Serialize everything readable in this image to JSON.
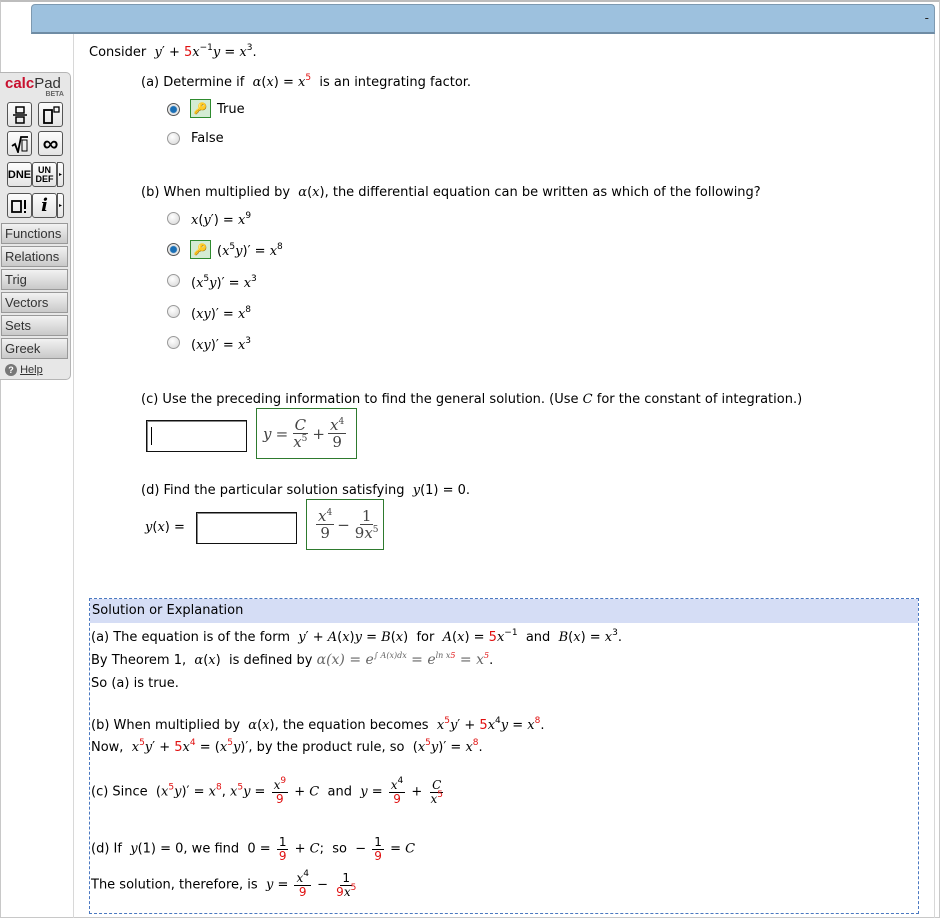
{
  "header": {
    "collapse_label": "-"
  },
  "calcpad": {
    "logo_calc": "calc",
    "logo_pad": "Pad",
    "beta": "BETA",
    "buttons": {
      "fraction": "▭/▭",
      "power": "▯°",
      "sqrt": "√▯",
      "infinity": "∞",
      "dne": "DNE",
      "undef_top": "UN",
      "undef_bottom": "DEF",
      "factorial": "▯!",
      "info": "i",
      "arrow": "▸"
    },
    "menus": [
      "Functions",
      "Relations",
      "Trig",
      "Vectors",
      "Sets",
      "Greek"
    ],
    "help_icon": "?",
    "help_label": "Help"
  },
  "problem": {
    "consider_label": "Consider",
    "part_a": {
      "prompt_pre": "(a) Determine if",
      "prompt_post": "is an integrating factor.",
      "options": [
        {
          "label": "True",
          "selected": true,
          "key_icon": "key-icon"
        },
        {
          "label": "False",
          "selected": false
        }
      ]
    },
    "part_b": {
      "prompt_pre": "(b) When multiplied by",
      "prompt_post": ", the differential equation can be written as which of the following?",
      "options": [
        {
          "label": "x(y') = x^9",
          "selected": false
        },
        {
          "label": "(x^5y)' = x^8",
          "selected": true
        },
        {
          "label": "(x^5y)' = x^3",
          "selected": false
        },
        {
          "label": "(xy)' = x^8",
          "selected": false
        },
        {
          "label": "(xy)' = x^3",
          "selected": false
        }
      ]
    },
    "part_c": {
      "prompt_pre": "(c) Use the preceding information to find the general solution. (Use",
      "prompt_c": "C",
      "prompt_post": "for the constant of integration.)",
      "input_value": "",
      "answer": "y = C/x^5 + x^4/9"
    },
    "part_d": {
      "prompt_pre": "(d) Find the particular solution satisfying",
      "prompt_post": "y(1) = 0.",
      "input_label": "y(x) =",
      "input_value": "",
      "answer": "x^4/9 − 1/(9x^5)"
    }
  },
  "solution": {
    "header": "Solution or Explanation",
    "a_line1_pre": "(a) The equation is of the form",
    "a_line1_for": "for",
    "a_line1_and": "and",
    "a_line2_pre": "By Theorem 1,",
    "a_line2_mid": "is defined by",
    "a_line3": "So (a) is true.",
    "b_line1_pre": "(b) When multiplied by",
    "b_line1_mid": ", the equation becomes",
    "b_line2_pre": "Now,",
    "b_line2_mid": ", by the product rule, so",
    "c_line_pre": "(c) Since",
    "c_line_and": "and",
    "d_line1_pre": "(d) If",
    "d_line1_mid": ", we find",
    "d_line1_so": "so",
    "d_line2_pre": "The solution, therefore, is"
  }
}
